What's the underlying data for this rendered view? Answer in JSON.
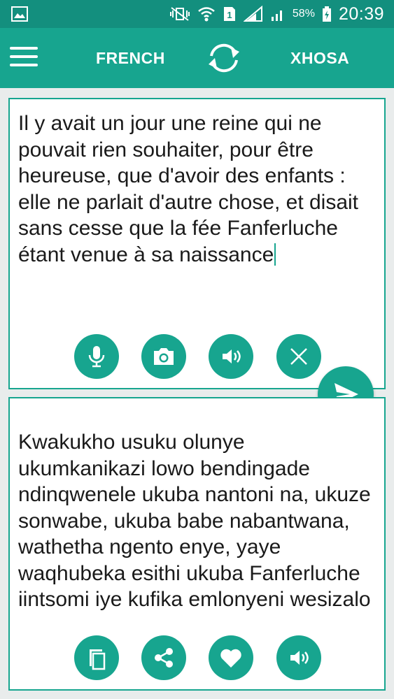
{
  "status_bar": {
    "battery_percent": "58%",
    "sim_slot": "1",
    "time": "20:39"
  },
  "toolbar": {
    "source_language": "FRENCH",
    "target_language": "XHOSA"
  },
  "input_card": {
    "text": "Il y avait un jour une reine qui ne pouvait rien souhaiter, pour être heureuse, que d'avoir des enfants : elle ne parlait d'autre chose, et disait sans cesse que la fée Fanferluche étant venue à sa naissance"
  },
  "output_card": {
    "text": "Kwakukho usuku olunye ukumkanikazi lowo bendingade ndinqwenele ukuba nantoni na, ukuze sonwabe, ukuba babe nabantwana, wathetha ngento enye, yaye waqhubeka esithi ukuba Fanferluche iintsomi iye kufika emlonyeni wesizalo"
  },
  "colors": {
    "accent": "#17a58f",
    "status_bar": "#138f7e",
    "background": "#e9ecec"
  },
  "icons": {
    "input_actions": [
      "microphone-icon",
      "camera-icon",
      "speaker-icon",
      "close-icon"
    ],
    "output_actions": [
      "copy-icon",
      "share-icon",
      "heart-icon",
      "speaker-icon"
    ],
    "toolbar": [
      "menu-icon",
      "swap-icon"
    ],
    "send": "send-icon"
  }
}
